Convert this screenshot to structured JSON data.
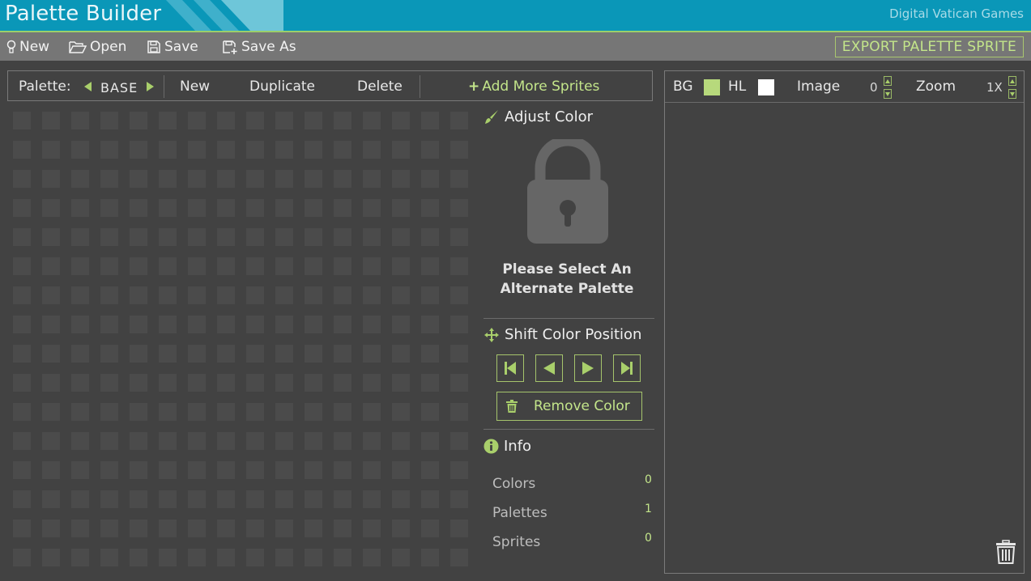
{
  "app": {
    "title": "Palette Builder",
    "brand": "Digital Vatican Games"
  },
  "menu": {
    "new": "New",
    "open": "Open",
    "save": "Save",
    "save_as": "Save As",
    "export": "EXPORT PALETTE SPRITE"
  },
  "palette_bar": {
    "label": "Palette:",
    "current": "BASE",
    "new": "New",
    "duplicate": "Duplicate",
    "delete": "Delete",
    "add_sprites": "Add More Sprites"
  },
  "grid": {
    "columns": 16,
    "rows": 16
  },
  "adjust": {
    "title": "Adjust Color",
    "message_line1": "Please Select An",
    "message_line2": "Alternate Palette"
  },
  "shift": {
    "title": "Shift Color Position",
    "remove": "Remove Color"
  },
  "info": {
    "title": "Info",
    "colors_label": "Colors",
    "colors_value": "0",
    "palettes_label": "Palettes",
    "palettes_value": "1",
    "sprites_label": "Sprites",
    "sprites_value": "0"
  },
  "preview": {
    "bg_label": "BG",
    "bg_color": "#b7d97c",
    "hl_label": "HL",
    "hl_color": "#ffffff",
    "image_label": "Image",
    "image_value": "0",
    "zoom_label": "Zoom",
    "zoom_value": "1X"
  },
  "colors": {
    "title_bar": "#0a97b8",
    "accent": "#c3e58a",
    "panel": "#424242"
  }
}
